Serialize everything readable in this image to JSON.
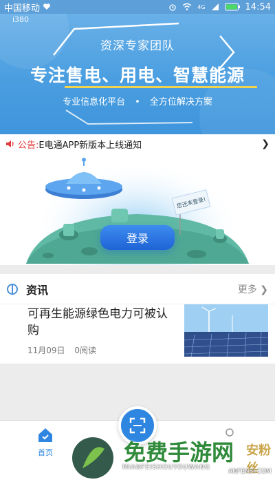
{
  "status": {
    "carrier": "中国移动",
    "signal": "4G",
    "time": "14:54"
  },
  "hero": {
    "brand": "i380",
    "team": "资深专家团队",
    "headline": "专注售电、用电、智慧能源",
    "sub_left": "专业信息化平台",
    "sub_right": "全方位解决方案"
  },
  "notice": {
    "label": "公告:",
    "text": "E电通APP新版本上线通知"
  },
  "login": {
    "button": "登录",
    "flag": "您还未登录!"
  },
  "news": {
    "title": "资讯",
    "more": "更多",
    "article": {
      "title": "可再生能源绿色电力可被认购",
      "date": "11月09日",
      "reads": "0阅读"
    }
  },
  "tabs": {
    "home": "首页"
  },
  "watermark": {
    "cn": "免费手游网",
    "en": "MIANFEISHOUYOUWANG",
    "site": "安粉丝",
    "site_en": "ANFENSI.COM"
  },
  "colors": {
    "primary": "#2e86e0",
    "notice": "#e23b3b",
    "accent": "#f1d34c"
  }
}
